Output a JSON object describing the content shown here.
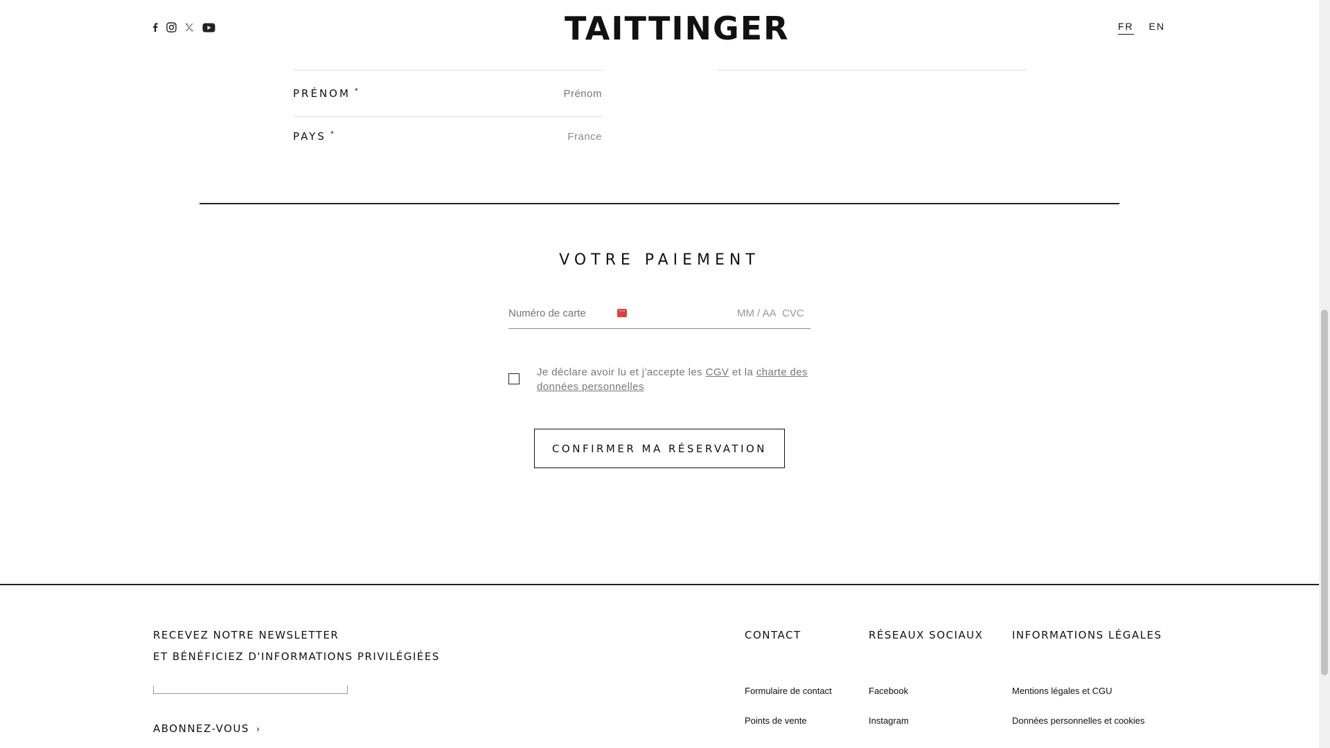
{
  "header": {
    "logo": "TAITTINGER",
    "social_icons": [
      "facebook-icon",
      "instagram-icon",
      "x-icon",
      "youtube-icon"
    ],
    "languages": [
      {
        "label": "FR",
        "active": true
      },
      {
        "label": "EN",
        "active": false
      }
    ]
  },
  "form": {
    "prenom": {
      "label": "PRÉNOM",
      "required_mark": "*",
      "placeholder": "Prénom"
    },
    "pays": {
      "label": "PAYS",
      "required_mark": "*",
      "value": "France"
    }
  },
  "payment": {
    "title": "VOTRE PAIEMENT",
    "card_number_placeholder": "Numéro de carte",
    "expiry_placeholder": "MM / AA",
    "cvc_placeholder": "CVC",
    "consent_prefix": "Je déclare avoir lu et j'accepte les ",
    "consent_cgv": "CGV",
    "consent_middle": " et la ",
    "consent_charter": "charte des données personnelles",
    "confirm_button": "CONFIRMER MA RÉSERVATION"
  },
  "footer": {
    "newsletter_line1": "RECEVEZ NOTRE NEWSLETTER",
    "newsletter_line2": "ET BÉNÉFICIEZ D'INFORMATIONS PRIVILÉGIÉES",
    "subscribe": "ABONNEZ-VOUS",
    "subscribe_chevron": "›",
    "columns": [
      {
        "title": "CONTACT",
        "links": [
          "Formulaire de contact",
          "Points de vente"
        ]
      },
      {
        "title": "RÉSEAUX SOCIAUX",
        "links": [
          "Facebook",
          "Instagram"
        ]
      },
      {
        "title": "INFORMATIONS LÉGALES",
        "links": [
          "Mentions légales et CGU",
          "Données personnelles et cookies"
        ]
      }
    ]
  },
  "colors": {
    "text": "#111111",
    "muted": "#8a8a8a",
    "card_icon": "#e0403a",
    "background": "#ffffff"
  }
}
